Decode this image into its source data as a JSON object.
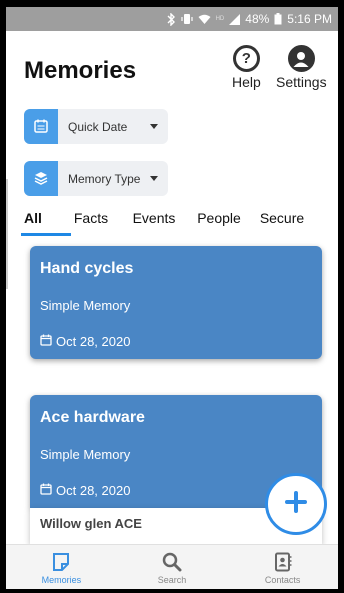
{
  "status_bar": {
    "battery": "48%",
    "time": "5:16 PM",
    "network_label": "HD"
  },
  "header": {
    "title": "Memories",
    "help_label": "Help",
    "help_glyph": "?",
    "settings_label": "Settings"
  },
  "filters": {
    "date_label": "Quick Date",
    "type_label": "Memory Type"
  },
  "tabs": [
    {
      "label": "All",
      "active": true
    },
    {
      "label": "Facts",
      "active": false
    },
    {
      "label": "Events",
      "active": false
    },
    {
      "label": "People",
      "active": false
    },
    {
      "label": "Secure",
      "active": false
    }
  ],
  "memories": [
    {
      "title": "Hand cycles",
      "type": "Simple Memory",
      "date": "Oct 28, 2020"
    },
    {
      "title": "Ace hardware",
      "type": "Simple Memory",
      "date": "Oct 28, 2020",
      "subtitle": "Willow glen ACE"
    }
  ],
  "fab": {
    "icon": "plus-icon"
  },
  "bottom_nav": [
    {
      "label": "Memories",
      "icon": "note-icon",
      "active": true
    },
    {
      "label": "Search",
      "icon": "search-icon",
      "active": false
    },
    {
      "label": "Contacts",
      "icon": "contacts-book-icon",
      "active": false
    }
  ],
  "colors": {
    "accent": "#1e88e5",
    "card": "#4a86c5",
    "status_bar": "#9e9e9e"
  }
}
